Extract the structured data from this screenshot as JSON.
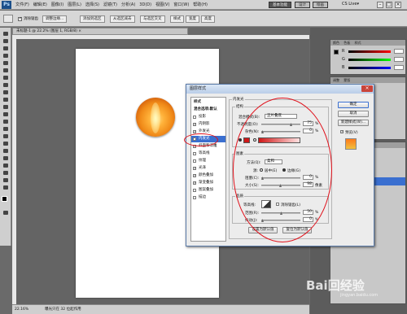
{
  "app": {
    "logo": "Ps",
    "menu": [
      "文件(F)",
      "编辑(E)",
      "图像(I)",
      "图层(L)",
      "选择(S)",
      "滤镜(T)",
      "分析(A)",
      "3D(D)",
      "视图(V)",
      "窗口(W)",
      "帮助(H)"
    ],
    "workspace_buttons": [
      "基本功能",
      "设计",
      "绘画"
    ],
    "cs_live": "CS Live▾",
    "window_controls": [
      "–",
      "□",
      "×"
    ]
  },
  "options_bar": {
    "buttons": [
      "调整边缘...",
      "添加到选区",
      "从选区减去",
      "与选区交叉",
      "样式",
      "宽度",
      "高度"
    ],
    "antialias_label": "消除锯齿"
  },
  "document": {
    "tab_title": "未标题-1 @ 22.2% (图层 1, RGB/8) ×",
    "status_zoom": "22.16%",
    "status_doc": "曝光只在 32 位起作用"
  },
  "panels": {
    "color_tabs": [
      "颜色",
      "色板",
      "样式"
    ],
    "color_labels": [
      "R",
      "G",
      "B"
    ],
    "adjust_tabs": [
      "调整",
      "蒙版"
    ],
    "layers_tabs": [
      "图层",
      "通道",
      "路径"
    ],
    "layer_names": [
      "图层 1",
      "背景"
    ]
  },
  "dialog": {
    "title": "图层样式",
    "close": "×",
    "style_list": [
      {
        "label": "样式",
        "checked": false,
        "has_cb": false
      },
      {
        "label": "混合选项:默认",
        "checked": false,
        "has_cb": false
      },
      {
        "label": "投影",
        "checked": false,
        "has_cb": true
      },
      {
        "label": "内阴影",
        "checked": true,
        "has_cb": true
      },
      {
        "label": "外发光",
        "checked": true,
        "has_cb": true
      },
      {
        "label": "内发光",
        "checked": true,
        "has_cb": true,
        "active": true
      },
      {
        "label": "斜面和浮雕",
        "checked": true,
        "has_cb": true
      },
      {
        "label": "等高线",
        "checked": false,
        "has_cb": true
      },
      {
        "label": "纹理",
        "checked": false,
        "has_cb": true
      },
      {
        "label": "光泽",
        "checked": true,
        "has_cb": true
      },
      {
        "label": "颜色叠加",
        "checked": true,
        "has_cb": true
      },
      {
        "label": "渐变叠加",
        "checked": true,
        "has_cb": true
      },
      {
        "label": "图案叠加",
        "checked": false,
        "has_cb": true
      },
      {
        "label": "描边",
        "checked": false,
        "has_cb": true
      }
    ],
    "inner_glow": {
      "section_title": "内发光",
      "structure_title": "结构",
      "blend_mode_label": "混合模式(B):",
      "blend_mode_value": "正片叠底",
      "opacity_label": "不透明度(O):",
      "opacity_value": "75",
      "noise_label": "杂色(N):",
      "noise_value": "0",
      "percent": "%",
      "elements_title": "图素",
      "method_label": "方法(Q):",
      "method_value": "柔和",
      "source_label": "源:",
      "source_center": "居中(E)",
      "source_edge": "边缘(G)",
      "choke_label": "阻塞(C):",
      "choke_value": "0",
      "size_label": "大小(S):",
      "size_value": "98",
      "size_unit": "像素",
      "quality_title": "品质",
      "contour_label": "等高线:",
      "antialias_label": "消除锯齿(L)",
      "range_label": "范围(R):",
      "range_value": "50",
      "jitter_label": "抖动(J):",
      "jitter_value": "0",
      "make_default": "设置为默认值",
      "reset_default": "复位为默认值"
    },
    "buttons": {
      "ok": "确定",
      "cancel": "取消",
      "new_style": "新建样式(W)...",
      "preview": "预览(V)"
    },
    "colors": {
      "glow_color": "#d01818",
      "list_active": "#3a6fd0"
    }
  },
  "watermark": {
    "brand": "Bai回经验",
    "url": "jingyan.baidu.com"
  }
}
